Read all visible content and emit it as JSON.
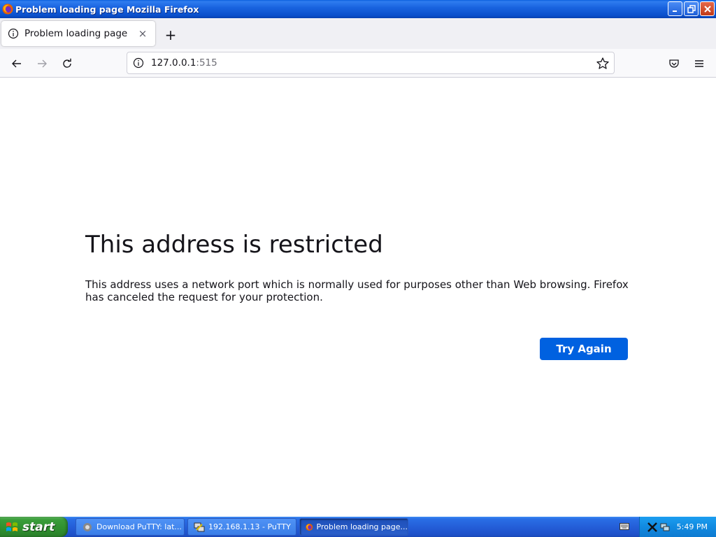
{
  "window": {
    "title": "Problem loading page  Mozilla Firefox"
  },
  "tabs": [
    {
      "label": "Problem loading page",
      "close_symbol": "×"
    }
  ],
  "newtab_symbol": "+",
  "urlbar": {
    "host": "127.0.0.1",
    "port": ":515"
  },
  "error": {
    "title": "This address is restricted",
    "description": "This address uses a network port which is normally used for purposes other than Web browsing. Firefox has canceled the request for your protection.",
    "button_label": "Try Again"
  },
  "taskbar": {
    "start_label": "start",
    "tasks": [
      {
        "label": "Download PuTTY: lat...",
        "icon": "putty-download-icon"
      },
      {
        "label": "192.168.1.13 - PuTTY",
        "icon": "putty-icon"
      },
      {
        "label": "Problem loading page...",
        "icon": "firefox-icon"
      }
    ],
    "clock": "5:49 PM"
  },
  "colors": {
    "accent_button": "#0061e0",
    "title_bar": "#1a64e0",
    "taskbar": "#245ed8",
    "start_button": "#3a9d3a"
  }
}
